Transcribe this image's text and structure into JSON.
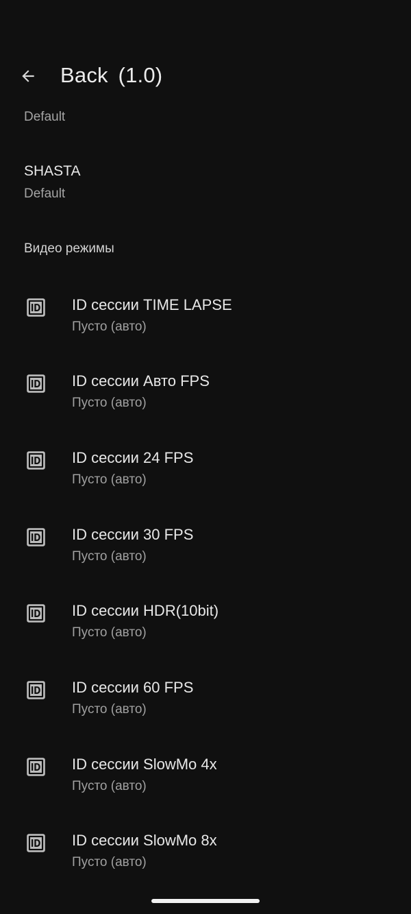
{
  "header": {
    "title": "Back",
    "version": "(1.0)"
  },
  "top_summary": "Default",
  "shasta": {
    "title": "SHASTA",
    "summary": "Default"
  },
  "category": {
    "title": "Видео режимы"
  },
  "items": [
    {
      "icon": "id-badge-icon",
      "title": "ID сессии TIME LAPSE",
      "summary": "Пусто (авто)"
    },
    {
      "icon": "id-badge-icon",
      "title": "ID сессии Авто FPS",
      "summary": "Пусто (авто)"
    },
    {
      "icon": "id-badge-icon",
      "title": "ID сессии 24 FPS",
      "summary": "Пусто (авто)"
    },
    {
      "icon": "id-badge-icon",
      "title": "ID сессии 30 FPS",
      "summary": "Пусто (авто)"
    },
    {
      "icon": "id-badge-icon",
      "title": "ID сессии HDR(10bit)",
      "summary": "Пусто (авто)"
    },
    {
      "icon": "id-badge-icon",
      "title": "ID сессии 60 FPS",
      "summary": "Пусто (авто)"
    },
    {
      "icon": "id-badge-icon",
      "title": "ID сессии SlowMo 4x",
      "summary": "Пусто (авто)"
    },
    {
      "icon": "id-badge-icon",
      "title": "ID сессии SlowMo 8x",
      "summary": "Пусто (авто)"
    }
  ],
  "colors": {
    "background": "#101010",
    "primary_text": "#e8e8e8",
    "secondary_text": "#a0a0a0"
  }
}
